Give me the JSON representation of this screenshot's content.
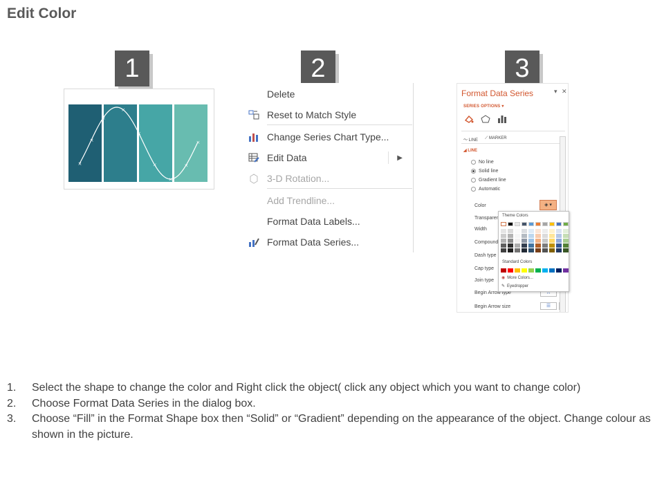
{
  "page": {
    "title": "Edit Color"
  },
  "steps": [
    "1",
    "2",
    "3"
  ],
  "chart": {
    "columns": [
      "#1f5f73",
      "#2d7e8c",
      "#46a6a6",
      "#68bcb0"
    ],
    "curve": "sine"
  },
  "context_menu": {
    "items": [
      {
        "label": "Delete",
        "icon": "none",
        "disabled": false
      },
      {
        "label": "Reset to Match Style",
        "icon": "reset-style-icon",
        "disabled": false
      },
      {
        "label": "Change Series Chart Type...",
        "icon": "bar-chart-icon",
        "disabled": false
      },
      {
        "label": "Edit Data",
        "icon": "edit-data-icon",
        "disabled": false,
        "submenu": true
      },
      {
        "label": "3-D Rotation...",
        "icon": "cube-icon",
        "disabled": true
      },
      {
        "label": "Add Trendline...",
        "icon": "none",
        "disabled": true
      },
      {
        "label": "Format Data Labels...",
        "icon": "none",
        "disabled": false
      },
      {
        "label": "Format Data Series...",
        "icon": "format-series-icon",
        "disabled": false
      }
    ]
  },
  "format_pane": {
    "title": "Format Data Series",
    "series_options": "SERIES OPTIONS",
    "tabs": [
      "LINE",
      "MARKER"
    ],
    "section": "LINE",
    "fill_options": [
      {
        "label": "No line",
        "selected": false
      },
      {
        "label": "Solid line",
        "selected": true
      },
      {
        "label": "Gradient line",
        "selected": false
      },
      {
        "label": "Automatic",
        "selected": false
      }
    ],
    "properties": [
      "Color",
      "Transparen",
      "Width",
      "Compound",
      "Dash type",
      "Cap type",
      "Join type",
      "Begin Arrow type",
      "Begin Arrow size"
    ],
    "accent_color": "#d2572f"
  },
  "palette": {
    "theme_label": "Theme Colors",
    "standard_label": "Standard Colors",
    "more_colors": "More Colors...",
    "eyedropper": "Eyedropper",
    "theme_top": [
      "#ffffff",
      "#000000",
      "#e7e6e6",
      "#44546a",
      "#5b9bd5",
      "#ed7d31",
      "#a5a5a5",
      "#ffc000",
      "#4472c4",
      "#70ad47"
    ],
    "standard": [
      "#c00000",
      "#ff0000",
      "#ffc000",
      "#ffff00",
      "#92d050",
      "#00b050",
      "#00b0f0",
      "#0070c0",
      "#002060",
      "#7030a0"
    ]
  },
  "instructions": [
    {
      "num": "1.",
      "text": "Select the shape to change the color and Right click the object( click any object which you want to change color)"
    },
    {
      "num": "2.",
      "text": "Choose Format Data Series in the dialog box."
    },
    {
      "num": "3.",
      "text": "Choose “Fill” in the Format Shape box then “Solid” or “Gradient” depending on the appearance of the object. Change colour as shown in the picture."
    }
  ]
}
